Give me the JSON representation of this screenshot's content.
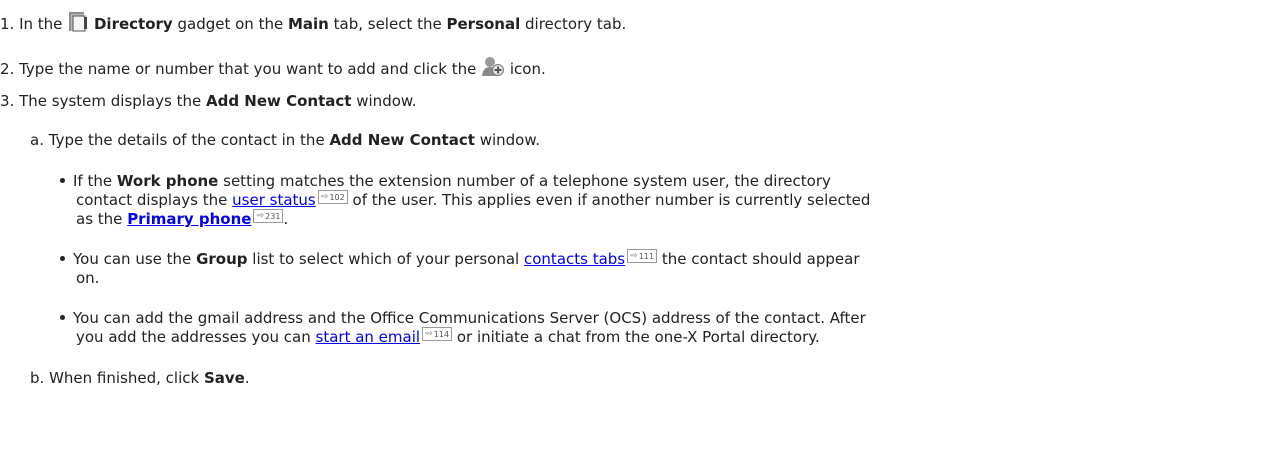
{
  "steps": [
    {
      "num": "1.",
      "t1": "In the",
      "b1": "Directory",
      "t2": "gadget on the",
      "b2": "Main",
      "t3": "tab, select the",
      "b3": "Personal",
      "t4": "directory tab."
    },
    {
      "num": "2.",
      "t1": "Type the name or number that you want to add and click the",
      "t2": "icon."
    },
    {
      "num": "3.",
      "t1": "The system displays the",
      "b1": "Add New Contact",
      "t2": "window."
    }
  ],
  "substeps": [
    {
      "num": "a.",
      "t1": "Type the details of the contact in the",
      "b1": "Add New Contact",
      "t2": "window."
    },
    {
      "num": "b.",
      "t1": "When finished, click",
      "b1": "Save",
      "t2": "."
    }
  ],
  "bullets": [
    {
      "t1": "If the",
      "b1": "Work phone",
      "t2": "setting matches the extension number of a telephone system user, the directory",
      "t3": "contact displays the",
      "link1": "user status",
      "ref1": "102",
      "t4": "of the user. This applies even if another number is currently selected",
      "t5": "as the",
      "link2": "Primary phone",
      "ref2": "231",
      "t6": "."
    },
    {
      "t1": "You can use the",
      "b1": "Group",
      "t2": "list to select which of your personal",
      "link1": "contacts tabs",
      "ref1": "111",
      "t3": "the contact should appear",
      "t4": "on."
    },
    {
      "t1": "You can add the gmail address and the Office Communications Server (OCS) address of the contact. After",
      "t2": "you add the addresses you can",
      "link1": "start an email",
      "ref1": "114",
      "t3": "or initiate a chat from the one-X Portal directory."
    }
  ],
  "icons": {
    "directory": "directory-gadget-icon",
    "add_contact": "add-contact-icon"
  }
}
